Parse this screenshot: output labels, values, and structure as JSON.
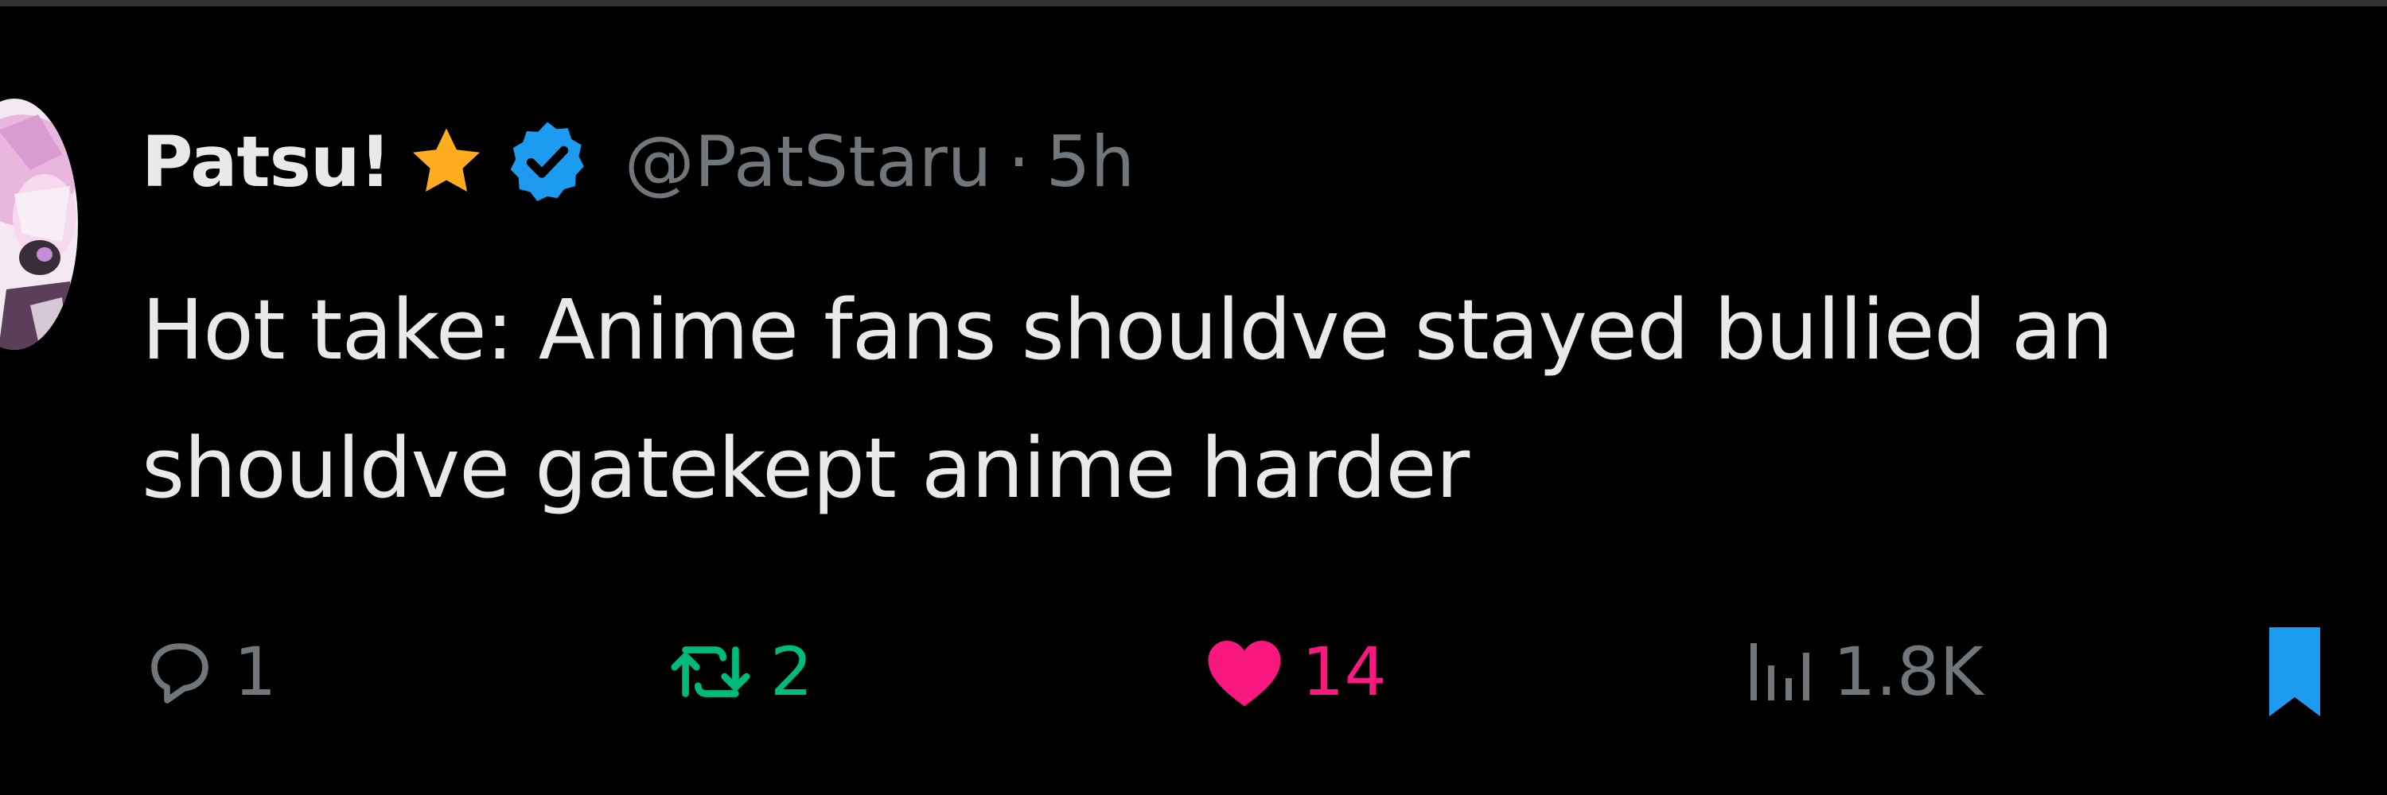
{
  "tweet": {
    "display_name": "Patsu!",
    "handle": "@PatStaru",
    "separator": "·",
    "time": "5h",
    "text_lines": [
      "Hot take: Anime fans shouldve stayed bullied an",
      "shouldve gatekept anime harder"
    ]
  },
  "actions": {
    "reply_count": "1",
    "retweet_count": "2",
    "like_count": "14",
    "views_count": "1.8K"
  },
  "icons": {
    "avatar": "avatar",
    "star": "star-icon",
    "verified": "verified-badge-icon",
    "reply": "reply-icon",
    "retweet": "retweet-icon",
    "like": "heart-icon",
    "views": "views-icon",
    "bookmark": "bookmark-icon"
  },
  "colors": {
    "background": "#000000",
    "text": "#e7e9ea",
    "muted": "#71767b",
    "star": "#ffad1f",
    "verified": "#1d9bf0",
    "retweet": "#00ba7c",
    "like": "#f91880",
    "bookmark": "#1d9bf0"
  }
}
